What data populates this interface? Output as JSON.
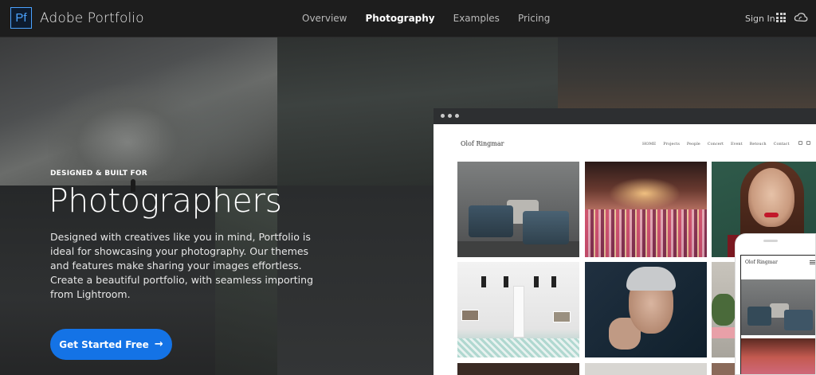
{
  "nav": {
    "logo_text": "Pf",
    "brand": "Adobe Portfolio",
    "links": [
      "Overview",
      "Photography",
      "Examples",
      "Pricing"
    ],
    "active_link": "Photography",
    "sign_in": "Sign In"
  },
  "hero": {
    "eyebrow": "DESIGNED & BUILT FOR",
    "title": "Photographers",
    "description": "Designed with creatives like you in mind, Portfolio is ideal for showcasing your photography. Our themes and features make sharing your images effortless. Create a beautiful portfolio, with seamless importing from Lightroom.",
    "cta_label": "Get Started Free",
    "cta_arrow": "→"
  },
  "mockup": {
    "site_name": "Olof Ringmar",
    "site_nav": [
      "HOME",
      "Projects",
      "People",
      "Concert",
      "Event",
      "Retouch",
      "Contact"
    ],
    "phone_site_name": "Olof Ringmar"
  },
  "colors": {
    "accent": "#1473e6",
    "logo": "#4ba3ff",
    "nav_bg": "#1d1d1d"
  },
  "icons": [
    "apps-grid-icon",
    "creative-cloud-icon",
    "arrow-right-icon",
    "hamburger-menu-icon"
  ]
}
